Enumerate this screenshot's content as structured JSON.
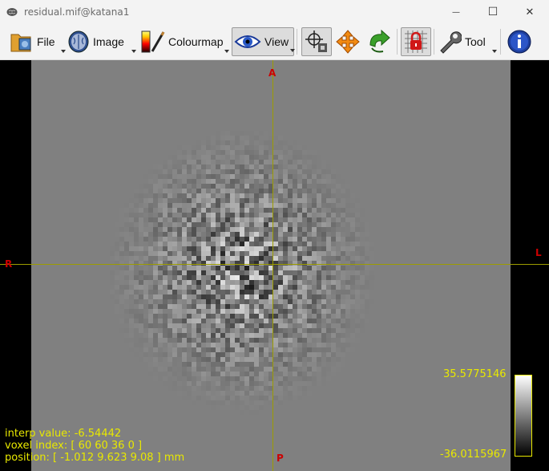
{
  "window": {
    "title": "residual.mif@katana1",
    "minimize_glyph": "—",
    "maximize_glyph": "☐",
    "close_glyph": "✕"
  },
  "toolbar": {
    "file_label": "File",
    "image_label": "Image",
    "colourmap_label": "Colourmap",
    "view_label": "View",
    "tool_label": "Tool"
  },
  "viewer": {
    "orientation": {
      "anterior": "A",
      "posterior": "P",
      "right": "R",
      "left": "L"
    },
    "colorbar": {
      "max": "35.5775146",
      "min": "-36.0115967"
    },
    "info": {
      "interp_value": "interp value: -6.54442",
      "voxel_index": "voxel index: [ 60 60 36 0 ]",
      "position": "position: [ -1.012 9.623 9.08 ] mm"
    }
  },
  "colors": {
    "accent": "#e8e800",
    "crosshair": "#9c9c00",
    "orientation": "#cc0000",
    "background": "#808080"
  }
}
